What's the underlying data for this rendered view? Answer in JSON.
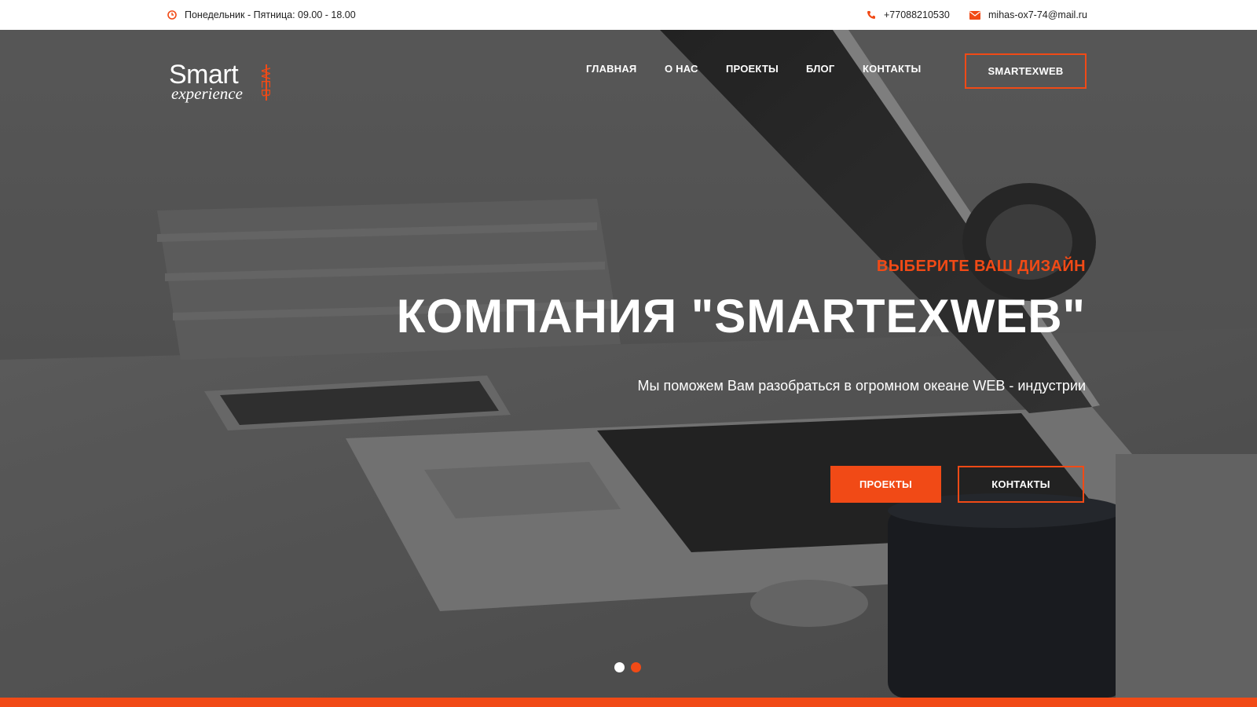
{
  "colors": {
    "accent": "#f14a16",
    "hero_overlay": "#555555",
    "topbar_bg": "#ffffff"
  },
  "topbar": {
    "hours": {
      "icon": "clock-icon",
      "text": "Понедельник - Пятница: 09.00 - 18.00"
    },
    "phone": {
      "icon": "phone-icon",
      "text": "+77088210530"
    },
    "email": {
      "icon": "envelope-icon",
      "text": "mihas-ox7-74@mail.ru"
    }
  },
  "logo": {
    "word": "Smart",
    "tagline": "experience",
    "vertical": "WEB"
  },
  "nav": {
    "items": [
      {
        "label": "ГЛАВНАЯ"
      },
      {
        "label": "О НАС"
      },
      {
        "label": "ПРОЕКТЫ"
      },
      {
        "label": "БЛОГ"
      },
      {
        "label": "КОНТАКТЫ"
      }
    ],
    "cta": "SMARTEXWEB"
  },
  "hero": {
    "kicker": "ВЫБЕРИТЕ ВАШ ДИЗАЙН",
    "headline": "КОМПАНИЯ \"SMARTEXWEB\"",
    "subtitle": "Мы поможем Вам разобраться в огромном океане WEB - индустрии",
    "buttons": [
      {
        "label": "ПРОЕКТЫ"
      },
      {
        "label": "КОНТАКТЫ"
      }
    ],
    "slider": {
      "slide_count": 2,
      "active_index": 2
    }
  }
}
